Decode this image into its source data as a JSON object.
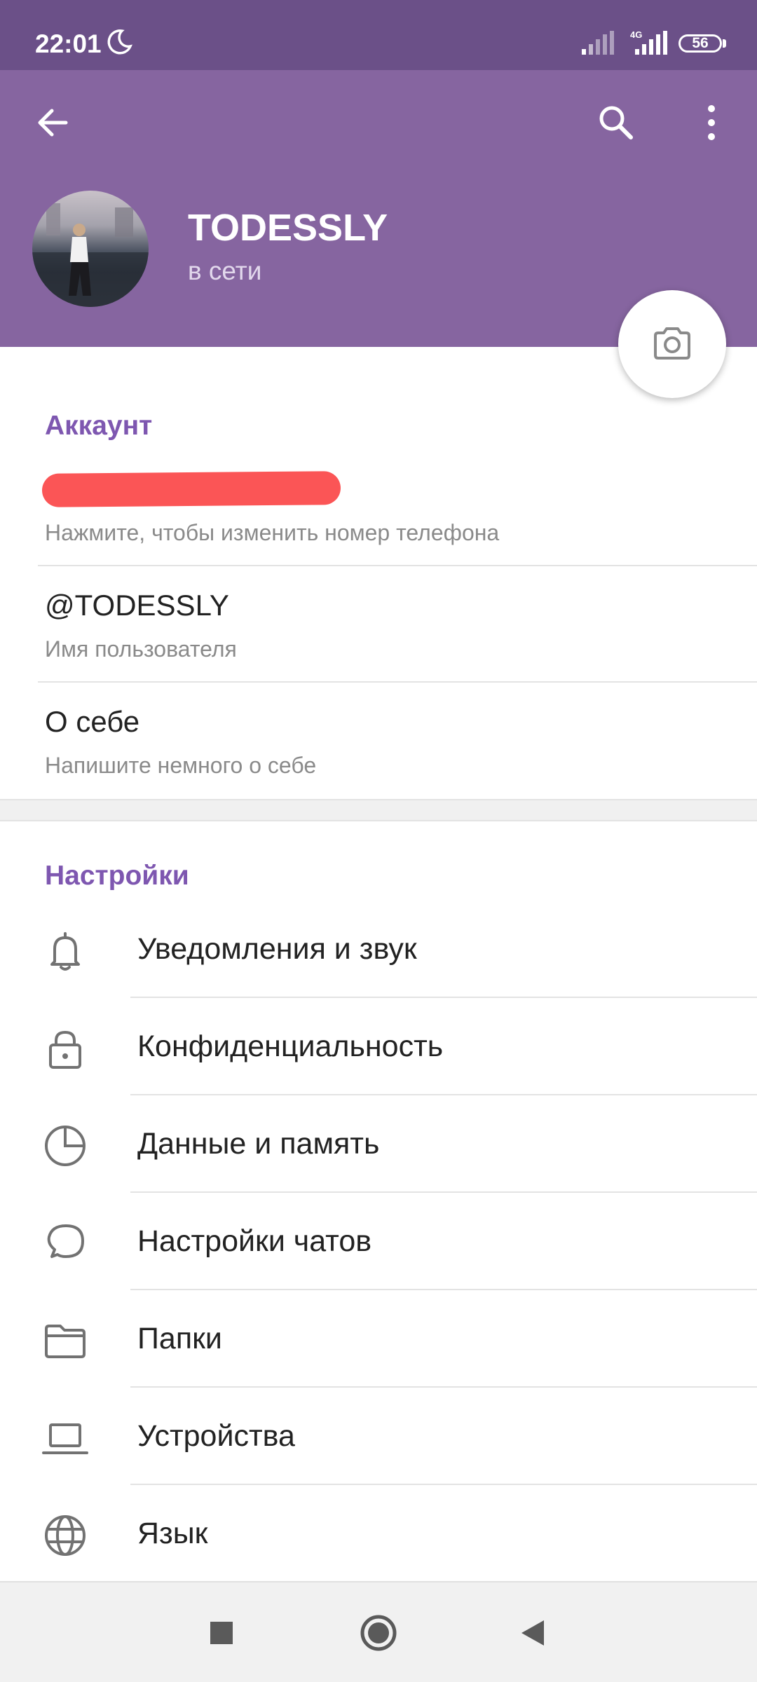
{
  "status_bar": {
    "time": "22:01",
    "network": "4G",
    "battery": "56"
  },
  "header": {
    "name": "TODESSLY",
    "status": "в сети",
    "color": "#8665a0"
  },
  "account": {
    "title": "Аккаунт",
    "phone_hint": "Нажмите, чтобы изменить номер телефона",
    "username": "@TODESSLY",
    "username_label": "Имя пользователя",
    "bio": "О себе",
    "bio_hint": "Напишите немного о себе"
  },
  "settings": {
    "title": "Настройки",
    "items": [
      {
        "label": "Уведомления и звук",
        "icon": "bell-icon"
      },
      {
        "label": "Конфиденциальность",
        "icon": "lock-icon"
      },
      {
        "label": "Данные и память",
        "icon": "pie-chart-icon"
      },
      {
        "label": "Настройки чатов",
        "icon": "chat-bubble-icon"
      },
      {
        "label": "Папки",
        "icon": "folder-icon"
      },
      {
        "label": "Устройства",
        "icon": "laptop-icon"
      },
      {
        "label": "Язык",
        "icon": "globe-icon"
      }
    ]
  },
  "colors": {
    "accent": "#7e57b0",
    "status_bar": "#6b5088"
  }
}
